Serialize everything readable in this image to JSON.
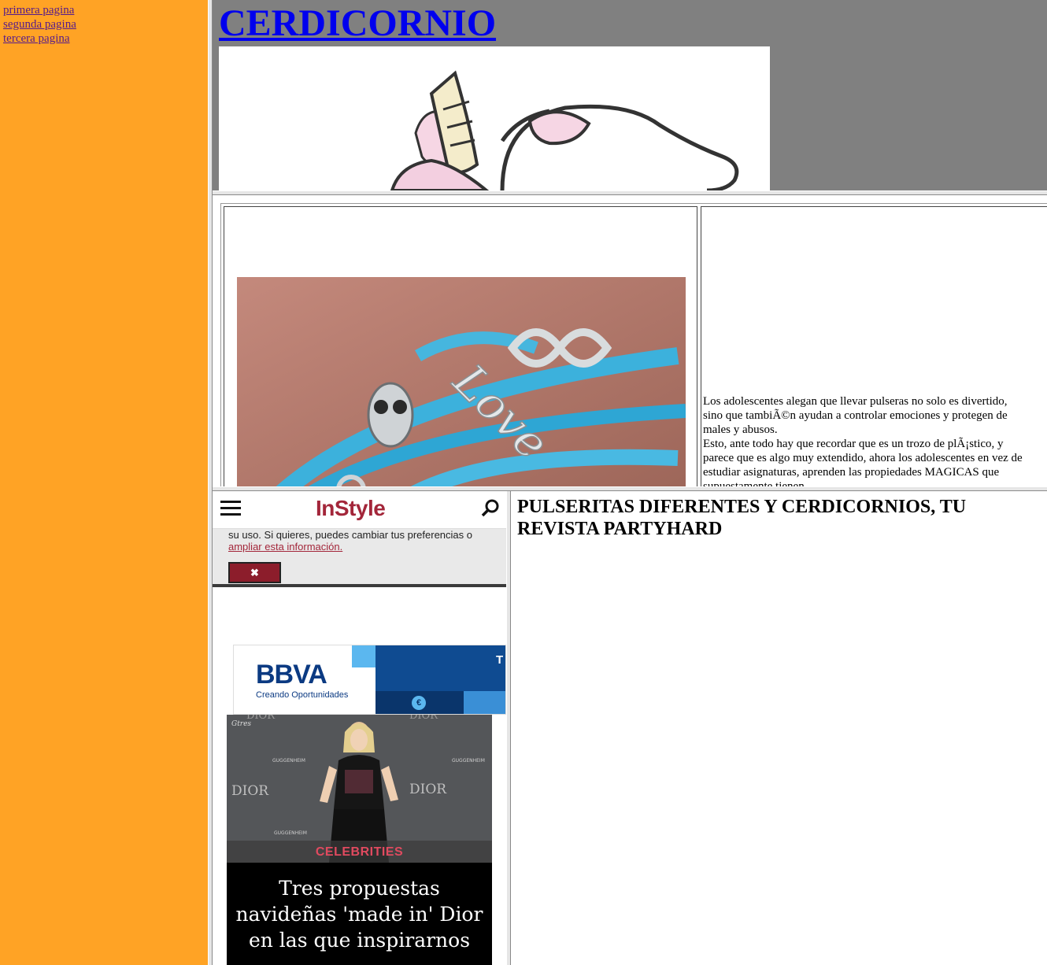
{
  "nav": {
    "links": [
      "primera pagina",
      "segunda pagina",
      "tercera pagina"
    ]
  },
  "header": {
    "title": "CERDICORNIO"
  },
  "content": {
    "article_lines": [
      "Los adolescentes alegan que llevar pulseras no solo es divertido,",
      "sino que tambiÃ©n ayudan a controlar emociones y protegen de",
      "males y abusos.",
      "Esto, ante todo hay que recordar que es un trozo de plÃ¡stico, y",
      "parece que es algo muy extendido, ahora los adolescentes en vez de",
      "estudiar asignaturas, aprenden las propiedades MAGICAS que",
      "supuestamente tienen."
    ],
    "bracelet_word": "Love"
  },
  "instyle": {
    "logo": "InStyle",
    "cookie_text": "su uso. Si quieres, puedes cambiar tus preferencias o",
    "cookie_link": "ampliar esta información.",
    "close_symbol": "✖",
    "ad": {
      "brand": "BBVA",
      "tagline": "Creando Oportunidades",
      "partial_text": "T",
      "coin_symbol": "€"
    },
    "card": {
      "photo_credit": "Gtres",
      "backdrop_words": [
        "DIOR",
        "DIOR",
        "DIOR",
        "DIOR",
        "GUGGENHEIM",
        "GUGGENHEIM",
        "GUGGENHEIM"
      ],
      "category": "CELEBRITIES",
      "title": "Tres propuestas navideñas 'made in' Dior en las que inspirarnos"
    }
  },
  "headline": {
    "text": "PULSERITAS DIFERENTES Y CERDICORNIOS, TU REVISTA PARTYHARD"
  },
  "colors": {
    "nav_bg": "#ffa325",
    "header_bg": "#808080",
    "link": "#0000ee",
    "visited_link": "#551a8b",
    "instyle_accent": "#a3263a",
    "bbva_blue": "#0f4b91"
  },
  "icons": {
    "menu": "hamburger-menu-icon",
    "search": "search-icon",
    "close": "close-icon",
    "coin": "euro-coin-icon"
  }
}
